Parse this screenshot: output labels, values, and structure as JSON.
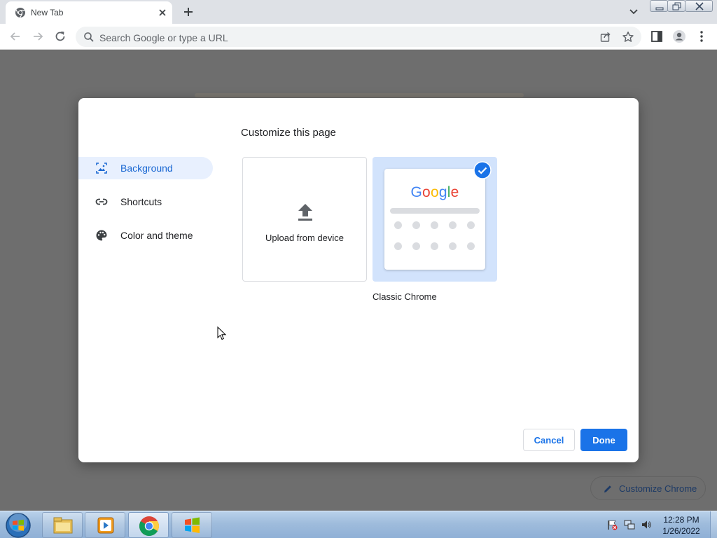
{
  "browser": {
    "tab": {
      "title": "New Tab"
    },
    "omnibox": {
      "placeholder": "Search Google or type a URL"
    }
  },
  "page": {
    "customize_chip_label": "Customize Chrome"
  },
  "dialog": {
    "title": "Customize this page",
    "menu": [
      {
        "label": "Background",
        "icon": "image-icon",
        "selected": true
      },
      {
        "label": "Shortcuts",
        "icon": "link-icon",
        "selected": false
      },
      {
        "label": "Color and theme",
        "icon": "palette-icon",
        "selected": false
      }
    ],
    "tiles": {
      "upload_label": "Upload from device",
      "classic_label": "Classic Chrome",
      "classic_logo": "Google",
      "classic_selected": true
    },
    "buttons": {
      "cancel": "Cancel",
      "done": "Done"
    }
  },
  "taskbar": {
    "apps": [
      "file-explorer-icon",
      "media-player-icon",
      "chrome-icon",
      "windows-flag-icon"
    ],
    "clock": {
      "time": "12:28 PM",
      "date": "1/26/2022"
    }
  },
  "colors": {
    "accent": "#1a73e8",
    "selected_bg": "#e8f0fe",
    "selected_text": "#1967d2",
    "tile_selected_bg": "#d2e3fc"
  }
}
